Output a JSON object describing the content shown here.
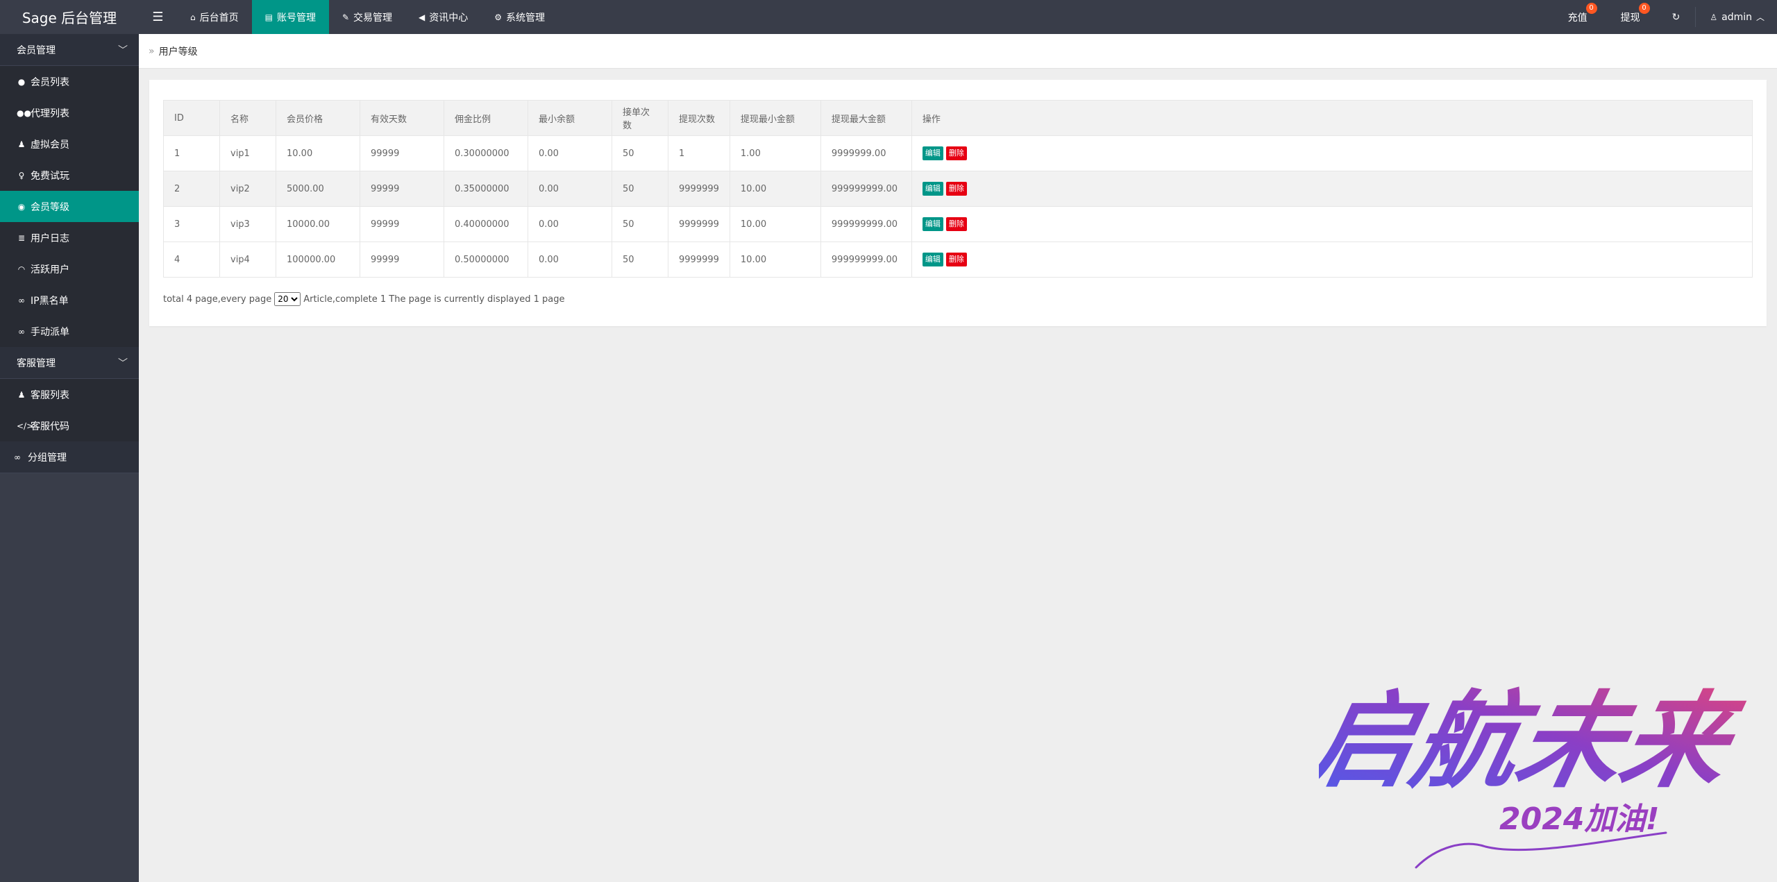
{
  "header": {
    "logo": "Sage 后台管理",
    "menu_icon": "menu-icon",
    "nav": [
      {
        "icon": "home-icon",
        "label": "后台首页",
        "active": false
      },
      {
        "icon": "id-card-icon",
        "label": "账号管理",
        "active": true
      },
      {
        "icon": "gavel-icon",
        "label": "交易管理",
        "active": false
      },
      {
        "icon": "bullhorn-icon",
        "label": "资讯中心",
        "active": false
      },
      {
        "icon": "cogs-icon",
        "label": "系统管理",
        "active": false
      }
    ],
    "recharge": {
      "label": "充值",
      "badge": "0"
    },
    "withdraw": {
      "label": "提现",
      "badge": "0"
    },
    "user": {
      "label": "admin"
    }
  },
  "sidebar": {
    "group1": {
      "label": "会员管理",
      "items": [
        {
          "label": "会员列表",
          "icon": "user-icon"
        },
        {
          "label": "代理列表",
          "icon": "users-icon"
        },
        {
          "label": "虚拟会员",
          "icon": "user-secret-icon"
        },
        {
          "label": "免费试玩",
          "icon": "female-icon"
        },
        {
          "label": "会员等级",
          "icon": "car-icon"
        },
        {
          "label": "用户日志",
          "icon": "list-icon"
        },
        {
          "label": "活跃用户",
          "icon": "wifi-icon"
        },
        {
          "label": "IP黑名单",
          "icon": "link-icon"
        },
        {
          "label": "手动派单",
          "icon": "link-icon"
        }
      ]
    },
    "group2": {
      "label": "客服管理",
      "items": [
        {
          "label": "客服列表",
          "icon": "user-secret-icon"
        },
        {
          "label": "客服代码",
          "icon": "code-icon"
        }
      ]
    },
    "group3": {
      "label": "分组管理",
      "icon": "link-icon"
    }
  },
  "breadcrumb": {
    "current": "用户等级"
  },
  "table": {
    "headers": [
      "ID",
      "名称",
      "会员价格",
      "有效天数",
      "佣金比例",
      "最小余额",
      "接单次数",
      "提现次数",
      "提现最小金额",
      "提现最大金额",
      "操作"
    ],
    "rows": [
      [
        "1",
        "vip1",
        "10.00",
        "99999",
        "0.30000000",
        "0.00",
        "50",
        "1",
        "1.00",
        "9999999.00"
      ],
      [
        "2",
        "vip2",
        "5000.00",
        "99999",
        "0.35000000",
        "0.00",
        "50",
        "9999999",
        "10.00",
        "999999999.00"
      ],
      [
        "3",
        "vip3",
        "10000.00",
        "99999",
        "0.40000000",
        "0.00",
        "50",
        "9999999",
        "10.00",
        "999999999.00"
      ],
      [
        "4",
        "vip4",
        "100000.00",
        "99999",
        "0.50000000",
        "0.00",
        "50",
        "9999999",
        "10.00",
        "999999999.00"
      ]
    ],
    "edit_label": "编辑",
    "delete_label": "删除"
  },
  "pager": {
    "prefix": "total 4 page,every page",
    "per_page": "20",
    "suffix": "Article,complete 1 The page is currently displayed 1 page"
  },
  "art": {
    "main_text": "启航未来",
    "sub_text": "2024加油!",
    "colors": {
      "start": "#4f5bea",
      "mid": "#8a3fc6",
      "end": "#e0457d"
    }
  },
  "colors": {
    "accent": "#009688",
    "header_bg": "#393d49",
    "badge": "#ff5722",
    "danger": "#e60012"
  }
}
